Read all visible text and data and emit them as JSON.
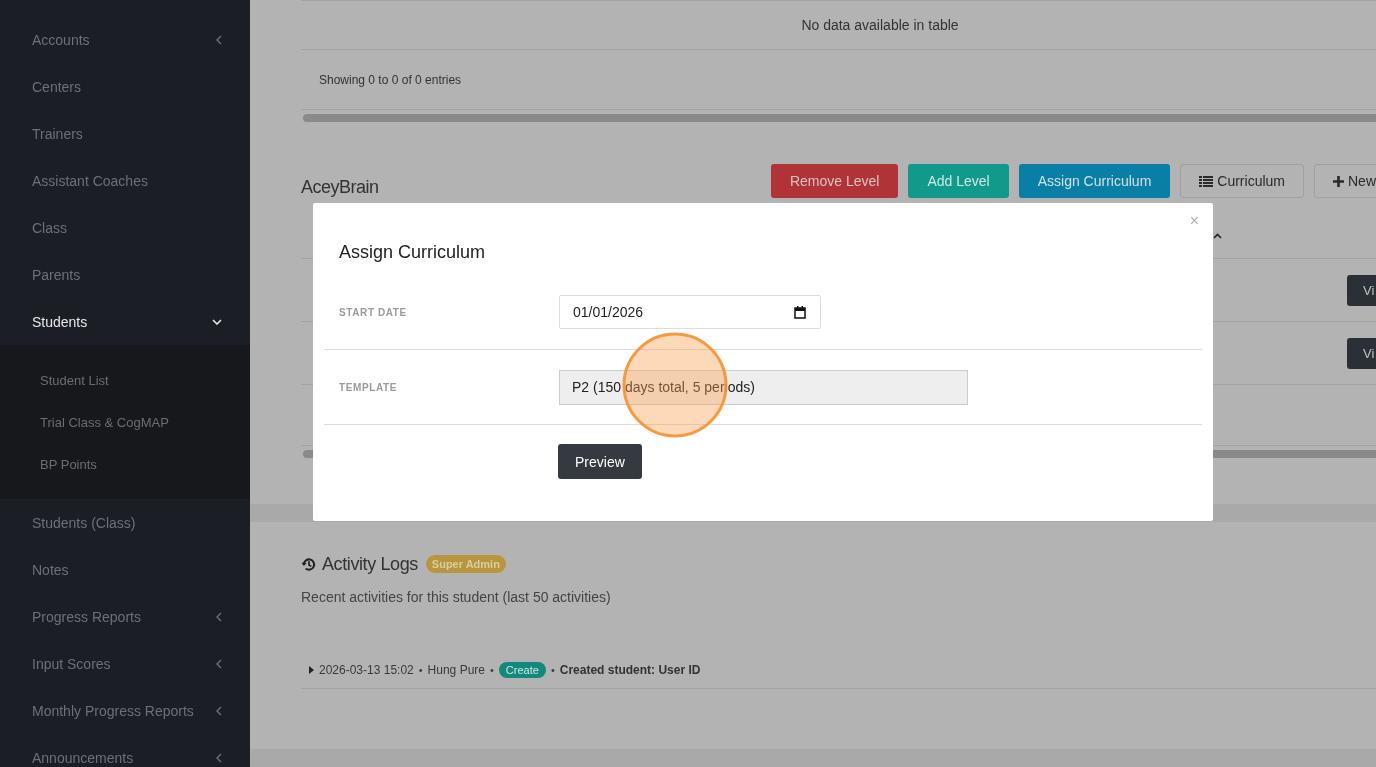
{
  "sidebar": {
    "items": [
      {
        "label": "Accounts",
        "kind": "group",
        "expanded": false,
        "selected": false
      },
      {
        "label": "Centers",
        "kind": "link",
        "selected": false
      },
      {
        "label": "Trainers",
        "kind": "link",
        "selected": false
      },
      {
        "label": "Assistant Coaches",
        "kind": "link",
        "selected": false
      },
      {
        "label": "Class",
        "kind": "link",
        "selected": false
      },
      {
        "label": "Parents",
        "kind": "link",
        "selected": false
      },
      {
        "label": "Students",
        "kind": "group",
        "expanded": true,
        "selected": true,
        "children": [
          {
            "label": "Student List"
          },
          {
            "label": "Trial Class & CogMAP"
          },
          {
            "label": "BP Points"
          }
        ]
      },
      {
        "label": "Students (Class)",
        "kind": "link",
        "selected": false
      },
      {
        "label": "Notes",
        "kind": "link",
        "selected": false
      },
      {
        "label": "Progress Reports",
        "kind": "group",
        "expanded": false,
        "selected": false
      },
      {
        "label": "Input Scores",
        "kind": "group",
        "expanded": false,
        "selected": false
      },
      {
        "label": "Monthly Progress Reports",
        "kind": "group",
        "expanded": false,
        "selected": false
      },
      {
        "label": "Announcements",
        "kind": "group",
        "expanded": false,
        "selected": false
      }
    ]
  },
  "table": {
    "empty_message": "No data available in table",
    "info": "Showing 0 to 0 of 0 entries"
  },
  "curriculum_section": {
    "title": "AceyBrain",
    "buttons": [
      {
        "label": "Remove Level",
        "kind": "danger"
      },
      {
        "label": "Add Level",
        "kind": "success"
      },
      {
        "label": "Assign Curriculum",
        "kind": "info"
      },
      {
        "label": "Curriculum",
        "kind": "list"
      },
      {
        "label": "New",
        "kind": "add"
      }
    ],
    "row_buttons": [
      "Vi",
      "Vi"
    ]
  },
  "modal": {
    "title": "Assign Curriculum",
    "close": "×",
    "fields": [
      {
        "label": "START DATE",
        "kind": "date",
        "value": "01/01/2026"
      },
      {
        "label": "TEMPLATE",
        "kind": "select",
        "value": "P2 (150 days total, 5 periods)"
      }
    ],
    "button": "Preview"
  },
  "activity_logs": {
    "title": "Activity Logs",
    "badge": "Super Admin",
    "subtitle": "Recent activities for this student (last 50 activities)",
    "entries": [
      {
        "time": "2026-03-13 15:02",
        "separator": "•",
        "user": "Hung Pure",
        "action": "Create",
        "message": "Created student: User ID"
      }
    ]
  }
}
